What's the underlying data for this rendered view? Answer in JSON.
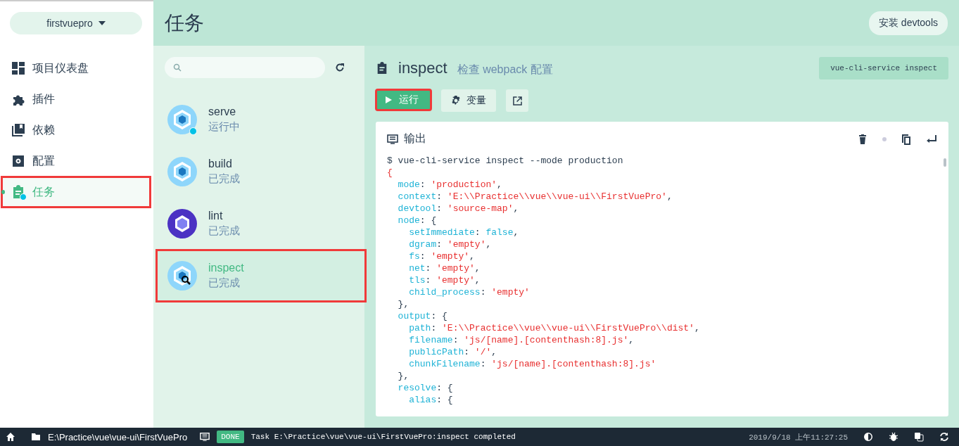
{
  "project_selector": {
    "label": "firstvuepro"
  },
  "nav": [
    {
      "label": "项目仪表盘",
      "selected": false,
      "highlighted": false,
      "notify": false
    },
    {
      "label": "插件",
      "selected": false,
      "highlighted": false,
      "notify": false
    },
    {
      "label": "依赖",
      "selected": false,
      "highlighted": false,
      "notify": false
    },
    {
      "label": "配置",
      "selected": false,
      "highlighted": false,
      "notify": false
    },
    {
      "label": "任务",
      "selected": true,
      "highlighted": true,
      "notify": true
    }
  ],
  "header": {
    "title": "任务",
    "devtools_button": "安装 devtools"
  },
  "tasks": [
    {
      "name": "serve",
      "status": "运行中",
      "running": true,
      "selected": false,
      "highlighted": false
    },
    {
      "name": "build",
      "status": "已完成",
      "running": false,
      "selected": false,
      "highlighted": false
    },
    {
      "name": "lint",
      "status": "已完成",
      "running": false,
      "selected": false,
      "highlighted": false
    },
    {
      "name": "inspect",
      "status": "已完成",
      "running": false,
      "selected": true,
      "highlighted": true
    }
  ],
  "task_detail": {
    "name": "inspect",
    "description": "检查 webpack 配置",
    "command": "vue-cli-service inspect",
    "run_button": {
      "label": "运行",
      "highlighted": true
    },
    "variables_button": "变量"
  },
  "output": {
    "title": "输出",
    "lines": [
      [
        {
          "kind": "plain",
          "text": "$ vue-cli-service inspect --mode production"
        }
      ],
      [
        {
          "kind": "str",
          "text": "{"
        }
      ],
      [
        {
          "kind": "key",
          "text": "  mode"
        },
        {
          "kind": "plain",
          "text": ": "
        },
        {
          "kind": "str",
          "text": "'production'"
        },
        {
          "kind": "plain",
          "text": ","
        }
      ],
      [
        {
          "kind": "key",
          "text": "  context"
        },
        {
          "kind": "plain",
          "text": ": "
        },
        {
          "kind": "str",
          "text": "'E:\\\\Practice\\\\vue\\\\vue-ui\\\\FirstVuePro'"
        },
        {
          "kind": "plain",
          "text": ","
        }
      ],
      [
        {
          "kind": "key",
          "text": "  devtool"
        },
        {
          "kind": "plain",
          "text": ": "
        },
        {
          "kind": "str",
          "text": "'source-map'"
        },
        {
          "kind": "plain",
          "text": ","
        }
      ],
      [
        {
          "kind": "key",
          "text": "  node"
        },
        {
          "kind": "plain",
          "text": ": {"
        }
      ],
      [
        {
          "kind": "key",
          "text": "    setImmediate"
        },
        {
          "kind": "plain",
          "text": ": "
        },
        {
          "kind": "key",
          "text": "false"
        },
        {
          "kind": "plain",
          "text": ","
        }
      ],
      [
        {
          "kind": "key",
          "text": "    dgram"
        },
        {
          "kind": "plain",
          "text": ": "
        },
        {
          "kind": "str",
          "text": "'empty'"
        },
        {
          "kind": "plain",
          "text": ","
        }
      ],
      [
        {
          "kind": "key",
          "text": "    fs"
        },
        {
          "kind": "plain",
          "text": ": "
        },
        {
          "kind": "str",
          "text": "'empty'"
        },
        {
          "kind": "plain",
          "text": ","
        }
      ],
      [
        {
          "kind": "key",
          "text": "    net"
        },
        {
          "kind": "plain",
          "text": ": "
        },
        {
          "kind": "str",
          "text": "'empty'"
        },
        {
          "kind": "plain",
          "text": ","
        }
      ],
      [
        {
          "kind": "key",
          "text": "    tls"
        },
        {
          "kind": "plain",
          "text": ": "
        },
        {
          "kind": "str",
          "text": "'empty'"
        },
        {
          "kind": "plain",
          "text": ","
        }
      ],
      [
        {
          "kind": "key",
          "text": "    child_process"
        },
        {
          "kind": "plain",
          "text": ": "
        },
        {
          "kind": "str",
          "text": "'empty'"
        }
      ],
      [
        {
          "kind": "plain",
          "text": "  },"
        }
      ],
      [
        {
          "kind": "key",
          "text": "  output"
        },
        {
          "kind": "plain",
          "text": ": {"
        }
      ],
      [
        {
          "kind": "key",
          "text": "    path"
        },
        {
          "kind": "plain",
          "text": ": "
        },
        {
          "kind": "str",
          "text": "'E:\\\\Practice\\\\vue\\\\vue-ui\\\\FirstVuePro\\\\dist'"
        },
        {
          "kind": "plain",
          "text": ","
        }
      ],
      [
        {
          "kind": "key",
          "text": "    filename"
        },
        {
          "kind": "plain",
          "text": ": "
        },
        {
          "kind": "str",
          "text": "'js/[name].[contenthash:8].js'"
        },
        {
          "kind": "plain",
          "text": ","
        }
      ],
      [
        {
          "kind": "key",
          "text": "    publicPath"
        },
        {
          "kind": "plain",
          "text": ": "
        },
        {
          "kind": "str",
          "text": "'/'"
        },
        {
          "kind": "plain",
          "text": ","
        }
      ],
      [
        {
          "kind": "key",
          "text": "    chunkFilename"
        },
        {
          "kind": "plain",
          "text": ": "
        },
        {
          "kind": "str",
          "text": "'js/[name].[contenthash:8].js'"
        }
      ],
      [
        {
          "kind": "plain",
          "text": "  },"
        }
      ],
      [
        {
          "kind": "key",
          "text": "  resolve"
        },
        {
          "kind": "plain",
          "text": ": {"
        }
      ],
      [
        {
          "kind": "key",
          "text": "    alias"
        },
        {
          "kind": "plain",
          "text": ": {"
        }
      ]
    ]
  },
  "status_bar": {
    "path": "E:\\Practice\\vue\\vue-ui\\FirstVuePro",
    "badge": "DONE",
    "message": "Task E:\\Practice\\vue\\vue-ui\\FirstVuePro:inspect completed",
    "time": "2019/9/18 上午11:27:25"
  }
}
